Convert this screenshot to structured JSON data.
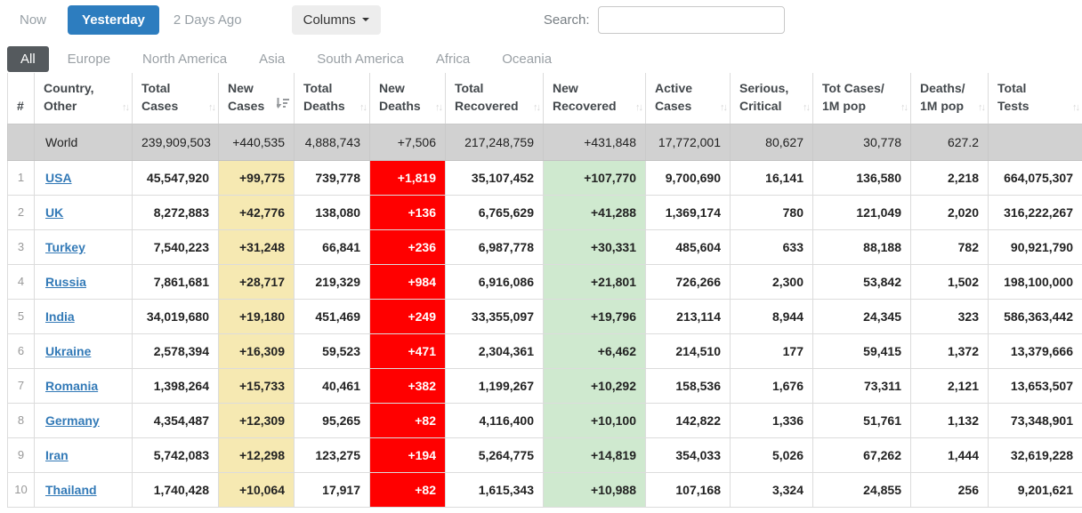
{
  "toolbar": {
    "now": "Now",
    "yesterday": "Yesterday",
    "two_days_ago": "2 Days Ago",
    "columns": "Columns",
    "search_label": "Search:",
    "search_value": ""
  },
  "region_tabs": [
    {
      "id": "all",
      "label": "All",
      "active": true
    },
    {
      "id": "europe",
      "label": "Europe",
      "active": false
    },
    {
      "id": "north-america",
      "label": "North America",
      "active": false
    },
    {
      "id": "asia",
      "label": "Asia",
      "active": false
    },
    {
      "id": "south-america",
      "label": "South America",
      "active": false
    },
    {
      "id": "africa",
      "label": "Africa",
      "active": false
    },
    {
      "id": "oceania",
      "label": "Oceania",
      "active": false
    }
  ],
  "colors": {
    "accent_blue": "#2d7dbf",
    "active_tab_gray": "#555a5e",
    "new_cases_yellow": "#f6e9b2",
    "new_deaths_red": "#ff0000",
    "new_recovered_green": "#cfe9cf",
    "world_row_gray": "#d1d1d1",
    "link_blue": "#337ab7"
  },
  "table": {
    "columns": [
      {
        "id": "rank",
        "line1": "",
        "line2": "#",
        "sort": "none",
        "icon": null
      },
      {
        "id": "country",
        "line1": "Country,",
        "line2": "Other",
        "sort": "both",
        "icon": "sort-icon"
      },
      {
        "id": "total_cases",
        "line1": "Total",
        "line2": "Cases",
        "sort": "both",
        "icon": "sort-icon"
      },
      {
        "id": "new_cases",
        "line1": "New",
        "line2": "Cases",
        "sort": "desc",
        "icon": "sort-descending-icon"
      },
      {
        "id": "total_deaths",
        "line1": "Total",
        "line2": "Deaths",
        "sort": "both",
        "icon": "sort-icon"
      },
      {
        "id": "new_deaths",
        "line1": "New",
        "line2": "Deaths",
        "sort": "both",
        "icon": "sort-icon"
      },
      {
        "id": "total_recovered",
        "line1": "Total",
        "line2": "Recovered",
        "sort": "both",
        "icon": "sort-icon"
      },
      {
        "id": "new_recovered",
        "line1": "New",
        "line2": "Recovered",
        "sort": "both",
        "icon": "sort-icon"
      },
      {
        "id": "active_cases",
        "line1": "Active",
        "line2": "Cases",
        "sort": "both",
        "icon": "sort-icon"
      },
      {
        "id": "serious_critical",
        "line1": "Serious,",
        "line2": "Critical",
        "sort": "both",
        "icon": "sort-icon"
      },
      {
        "id": "cases_per_1m",
        "line1": "Tot Cases/",
        "line2": "1M pop",
        "sort": "both",
        "icon": "sort-icon"
      },
      {
        "id": "deaths_per_1m",
        "line1": "Deaths/",
        "line2": "1M pop",
        "sort": "both",
        "icon": "sort-icon"
      },
      {
        "id": "total_tests",
        "line1": "Total",
        "line2": "Tests",
        "sort": "both",
        "icon": "sort-icon"
      }
    ],
    "world_row": {
      "rank": "",
      "country": "World",
      "total_cases": "239,909,503",
      "new_cases": "+440,535",
      "total_deaths": "4,888,743",
      "new_deaths": "+7,506",
      "total_recovered": "217,248,759",
      "new_recovered": "+431,848",
      "active_cases": "17,772,001",
      "serious_critical": "80,627",
      "cases_per_1m": "30,778",
      "deaths_per_1m": "627.2",
      "total_tests": ""
    },
    "rows": [
      {
        "rank": "1",
        "country": "USA",
        "total_cases": "45,547,920",
        "new_cases": "+99,775",
        "total_deaths": "739,778",
        "new_deaths": "+1,819",
        "total_recovered": "35,107,452",
        "new_recovered": "+107,770",
        "active_cases": "9,700,690",
        "serious_critical": "16,141",
        "cases_per_1m": "136,580",
        "deaths_per_1m": "2,218",
        "total_tests": "664,075,307"
      },
      {
        "rank": "2",
        "country": "UK",
        "total_cases": "8,272,883",
        "new_cases": "+42,776",
        "total_deaths": "138,080",
        "new_deaths": "+136",
        "total_recovered": "6,765,629",
        "new_recovered": "+41,288",
        "active_cases": "1,369,174",
        "serious_critical": "780",
        "cases_per_1m": "121,049",
        "deaths_per_1m": "2,020",
        "total_tests": "316,222,267"
      },
      {
        "rank": "3",
        "country": "Turkey",
        "total_cases": "7,540,223",
        "new_cases": "+31,248",
        "total_deaths": "66,841",
        "new_deaths": "+236",
        "total_recovered": "6,987,778",
        "new_recovered": "+30,331",
        "active_cases": "485,604",
        "serious_critical": "633",
        "cases_per_1m": "88,188",
        "deaths_per_1m": "782",
        "total_tests": "90,921,790"
      },
      {
        "rank": "4",
        "country": "Russia",
        "total_cases": "7,861,681",
        "new_cases": "+28,717",
        "total_deaths": "219,329",
        "new_deaths": "+984",
        "total_recovered": "6,916,086",
        "new_recovered": "+21,801",
        "active_cases": "726,266",
        "serious_critical": "2,300",
        "cases_per_1m": "53,842",
        "deaths_per_1m": "1,502",
        "total_tests": "198,100,000"
      },
      {
        "rank": "5",
        "country": "India",
        "total_cases": "34,019,680",
        "new_cases": "+19,180",
        "total_deaths": "451,469",
        "new_deaths": "+249",
        "total_recovered": "33,355,097",
        "new_recovered": "+19,796",
        "active_cases": "213,114",
        "serious_critical": "8,944",
        "cases_per_1m": "24,345",
        "deaths_per_1m": "323",
        "total_tests": "586,363,442"
      },
      {
        "rank": "6",
        "country": "Ukraine",
        "total_cases": "2,578,394",
        "new_cases": "+16,309",
        "total_deaths": "59,523",
        "new_deaths": "+471",
        "total_recovered": "2,304,361",
        "new_recovered": "+6,462",
        "active_cases": "214,510",
        "serious_critical": "177",
        "cases_per_1m": "59,415",
        "deaths_per_1m": "1,372",
        "total_tests": "13,379,666"
      },
      {
        "rank": "7",
        "country": "Romania",
        "total_cases": "1,398,264",
        "new_cases": "+15,733",
        "total_deaths": "40,461",
        "new_deaths": "+382",
        "total_recovered": "1,199,267",
        "new_recovered": "+10,292",
        "active_cases": "158,536",
        "serious_critical": "1,676",
        "cases_per_1m": "73,311",
        "deaths_per_1m": "2,121",
        "total_tests": "13,653,507"
      },
      {
        "rank": "8",
        "country": "Germany",
        "total_cases": "4,354,487",
        "new_cases": "+12,309",
        "total_deaths": "95,265",
        "new_deaths": "+82",
        "total_recovered": "4,116,400",
        "new_recovered": "+10,100",
        "active_cases": "142,822",
        "serious_critical": "1,336",
        "cases_per_1m": "51,761",
        "deaths_per_1m": "1,132",
        "total_tests": "73,348,901"
      },
      {
        "rank": "9",
        "country": "Iran",
        "total_cases": "5,742,083",
        "new_cases": "+12,298",
        "total_deaths": "123,275",
        "new_deaths": "+194",
        "total_recovered": "5,264,775",
        "new_recovered": "+14,819",
        "active_cases": "354,033",
        "serious_critical": "5,026",
        "cases_per_1m": "67,262",
        "deaths_per_1m": "1,444",
        "total_tests": "32,619,228"
      },
      {
        "rank": "10",
        "country": "Thailand",
        "total_cases": "1,740,428",
        "new_cases": "+10,064",
        "total_deaths": "17,917",
        "new_deaths": "+82",
        "total_recovered": "1,615,343",
        "new_recovered": "+10,988",
        "active_cases": "107,168",
        "serious_critical": "3,324",
        "cases_per_1m": "24,855",
        "deaths_per_1m": "256",
        "total_tests": "9,201,621"
      }
    ]
  }
}
